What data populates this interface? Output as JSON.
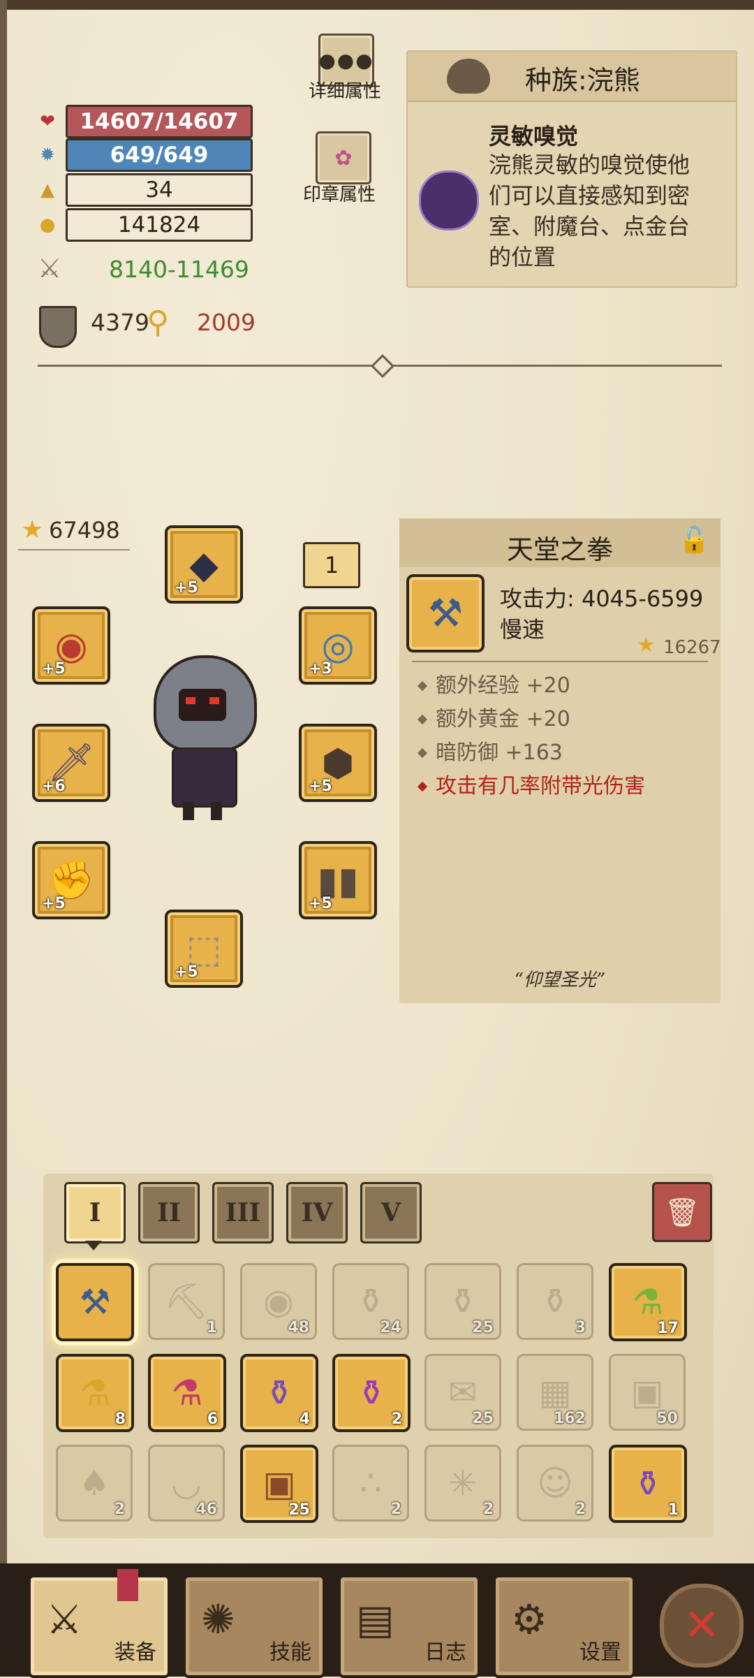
{
  "stats": {
    "hp": "14607/14607",
    "mp": "649/649",
    "level": "34",
    "gold": "141824",
    "attack": "8140-11469",
    "armor": "4379",
    "magic_resist": "2009"
  },
  "buttons": {
    "detail_attrs": "详细属性",
    "seal_attrs": "印章属性"
  },
  "race": {
    "title": "种族:浣熊",
    "ability_name": "灵敏嗅觉",
    "ability_desc": "浣熊灵敏的嗅觉使他们可以直接感知到密室、附魔台、点金台的位置"
  },
  "equipment": {
    "total_score": "67498",
    "amulet_count": "1",
    "slots": [
      {
        "name": "helmet",
        "level": "+5",
        "icon": "hood-icon"
      },
      {
        "name": "eye-amulet",
        "level": "+5",
        "icon": "eye-icon"
      },
      {
        "name": "ring",
        "level": "+3",
        "icon": "ring-icon"
      },
      {
        "name": "weapon",
        "level": "+6",
        "icon": "dagger-icon"
      },
      {
        "name": "chest",
        "level": "+5",
        "icon": "chest-armor-icon"
      },
      {
        "name": "gloves",
        "level": "+5",
        "icon": "gauntlet-icon"
      },
      {
        "name": "legs",
        "level": "+5",
        "icon": "leg-armor-icon"
      },
      {
        "name": "boots",
        "level": "+5",
        "icon": "boots-icon"
      }
    ]
  },
  "item": {
    "name": "天堂之拳",
    "attack": "攻击力: 4045-6599",
    "speed": "慢速",
    "score": "16267",
    "props": [
      "额外经验 +20",
      "额外黄金 +20",
      "暗防御 +163"
    ],
    "special": "攻击有几率附带光伤害",
    "quote": "“仰望圣光”"
  },
  "inventory": {
    "tabs": [
      "I",
      "II",
      "III",
      "IV",
      "V"
    ],
    "active_tab": "I",
    "rows": [
      [
        {
          "icon": "hammer-icon",
          "count": "",
          "state": "sel"
        },
        {
          "icon": "pickaxe-icon",
          "count": "1",
          "state": "dim"
        },
        {
          "icon": "map-eye-icon",
          "count": "48",
          "state": "dim"
        },
        {
          "icon": "orange-potion-icon",
          "count": "24",
          "state": "dim"
        },
        {
          "icon": "teal-potion-icon",
          "count": "25",
          "state": "dim"
        },
        {
          "icon": "red-potion-icon",
          "count": "3",
          "state": "dim"
        },
        {
          "icon": "green-potion-icon",
          "count": "17",
          "state": "on"
        }
      ],
      [
        {
          "icon": "yellow-potion-icon",
          "count": "8",
          "state": "on"
        },
        {
          "icon": "pink-potion-icon",
          "count": "6",
          "state": "on"
        },
        {
          "icon": "purple-potion-icon",
          "count": "4",
          "state": "on"
        },
        {
          "icon": "magenta-potion-icon",
          "count": "2",
          "state": "on"
        },
        {
          "icon": "scroll-icon",
          "count": "25",
          "state": "dim"
        },
        {
          "icon": "stone-icon",
          "count": "162",
          "state": "dim"
        },
        {
          "icon": "crate-icon",
          "count": "50",
          "state": "dim"
        }
      ],
      [
        {
          "icon": "shovel-icon",
          "count": "2",
          "state": "dim"
        },
        {
          "icon": "bowl-icon",
          "count": "46",
          "state": "dim"
        },
        {
          "icon": "treasure-chest-icon",
          "count": "25",
          "state": "on"
        },
        {
          "icon": "seeds-icon",
          "count": "2",
          "state": "dim"
        },
        {
          "icon": "web-icon",
          "count": "2",
          "state": "dim"
        },
        {
          "icon": "doll-icon",
          "count": "2",
          "state": "dim"
        },
        {
          "icon": "violet-potion-icon",
          "count": "1",
          "state": "on"
        }
      ]
    ]
  },
  "nav": {
    "equip": "装备",
    "skills": "技能",
    "log": "日志",
    "settings": "设置"
  },
  "colors": {
    "hp_bar": "#b5565b",
    "mp_bar": "#4f86b8",
    "attack_text": "#3e8b2f",
    "magic_resist_text": "#a33a2a",
    "special_text": "#b22218",
    "slot_gold": "#e7b24a"
  }
}
